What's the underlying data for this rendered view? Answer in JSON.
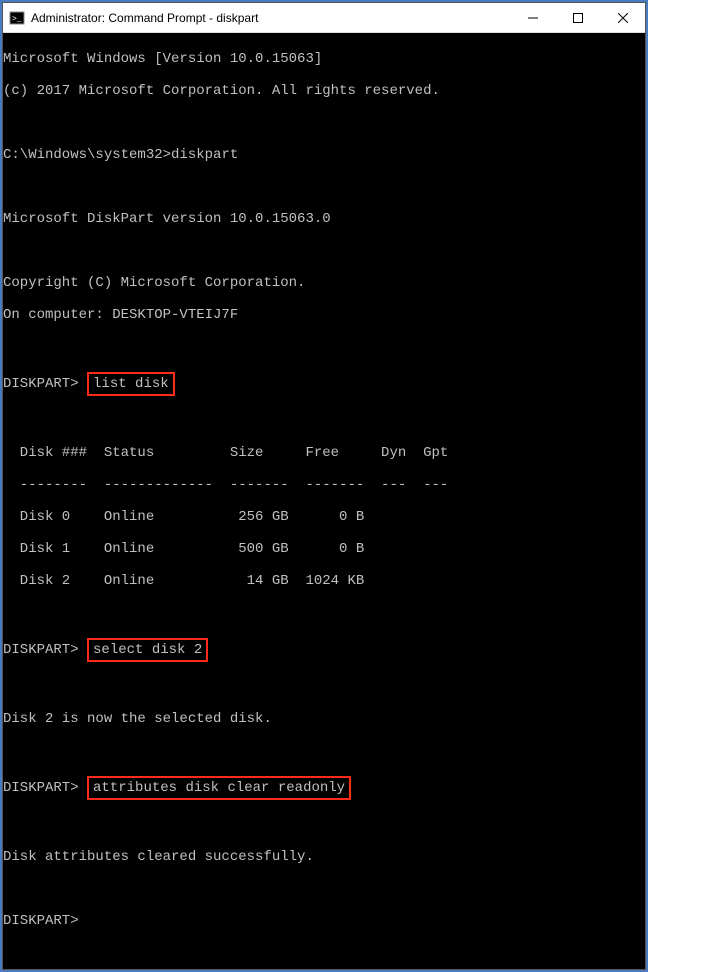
{
  "titlebar": {
    "title": "Administrator: Command Prompt - diskpart"
  },
  "terminal": {
    "banner1": "Microsoft Windows [Version 10.0.15063]",
    "banner2": "(c) 2017 Microsoft Corporation. All rights reserved.",
    "prompt_path": "C:\\Windows\\system32>",
    "cmd_diskpart": "diskpart",
    "dp_version": "Microsoft DiskPart version 10.0.15063.0",
    "dp_copyright": "Copyright (C) Microsoft Corporation.",
    "dp_computer": "On computer: DESKTOP-VTEIJ7F",
    "dp_prompt": "DISKPART>",
    "cmd_list": "list disk",
    "cmd_select": "select disk 2",
    "cmd_attr": "attributes disk clear readonly",
    "table": {
      "header": "  Disk ###  Status         Size     Free     Dyn  Gpt",
      "divider": "  --------  -------------  -------  -------  ---  ---",
      "rows": [
        "  Disk 0    Online          256 GB      0 B",
        "  Disk 1    Online          500 GB      0 B",
        "  Disk 2    Online           14 GB  1024 KB"
      ]
    },
    "msg_selected": "Disk 2 is now the selected disk.",
    "msg_cleared": "Disk attributes cleared successfully."
  }
}
